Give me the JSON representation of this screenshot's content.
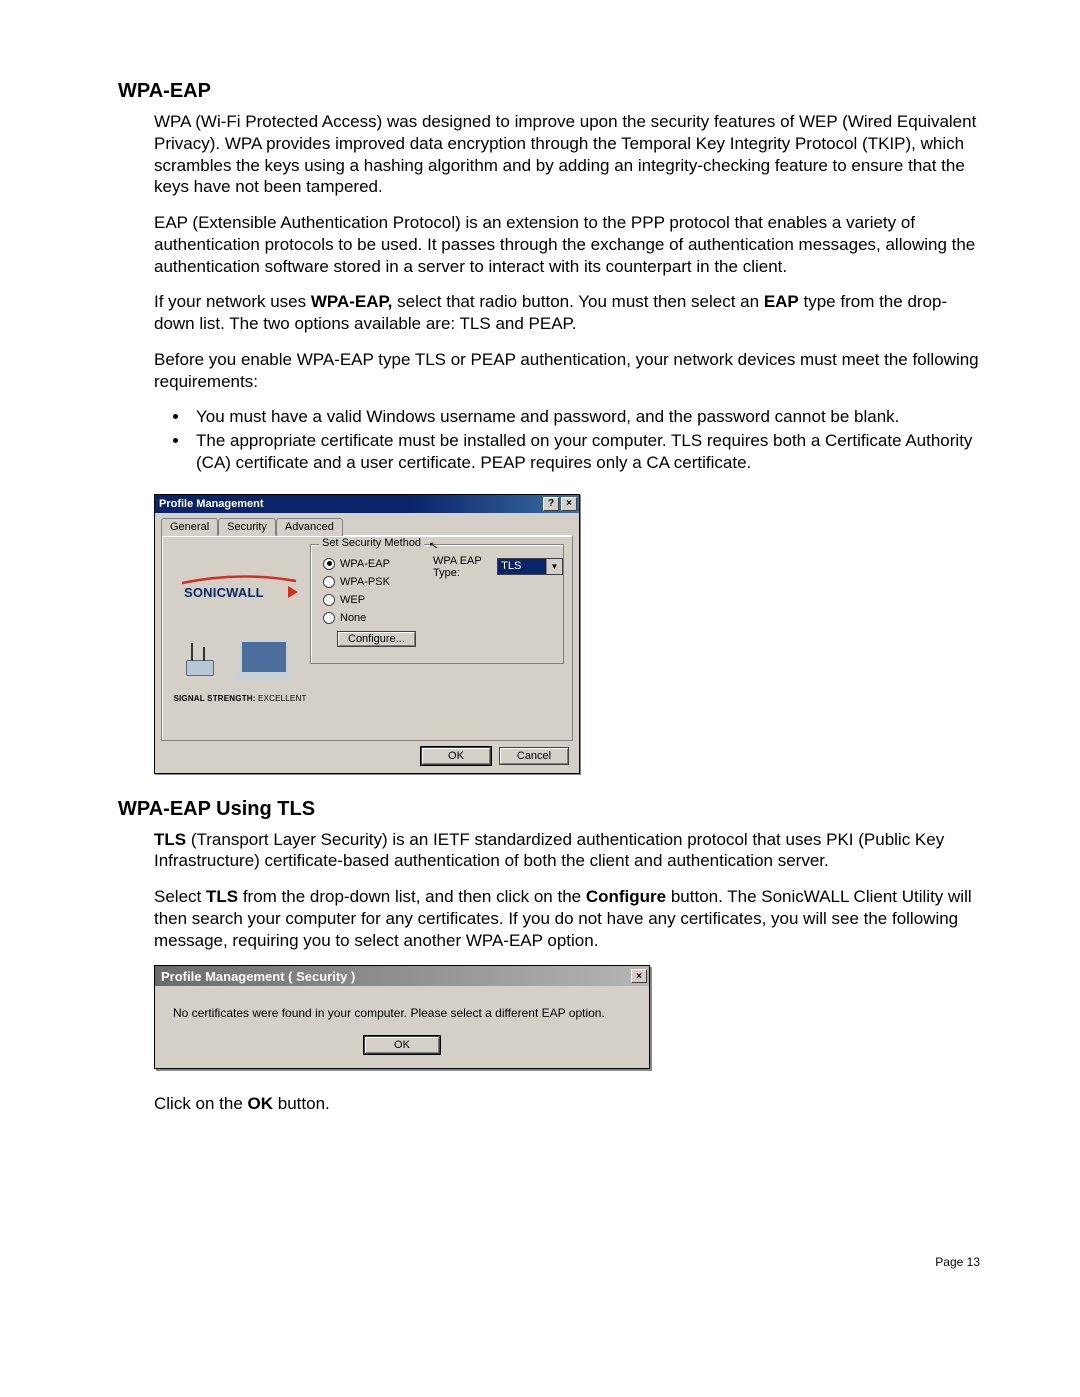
{
  "section1": {
    "heading": "WPA-EAP",
    "p1_a": "WPA (Wi-Fi Protected Access) was designed to improve upon the security features of WEP (Wired Equivalent Privacy). WPA provides improved data encryption through the Temporal Key Integrity Protocol (TKIP), which scrambles the keys using a hashing algorithm and by adding an integrity-checking feature to ensure that the keys have not been tampered.",
    "p2": "EAP (Extensible Authentication Protocol) is an extension to the PPP protocol that enables a variety of authentication protocols to be used. It passes through the exchange of authentication messages, allowing the authentication software stored in a server to interact with its counterpart in the client.",
    "p3_pre": "If your network uses ",
    "p3_b1": "WPA-EAP,",
    "p3_mid": " select that radio button. You must then select an ",
    "p3_b2": "EAP",
    "p3_post": " type from the drop-down list. The two options available are: TLS and PEAP.",
    "p4": "Before you enable WPA-EAP type TLS or PEAP authentication, your network devices must meet the following requirements:",
    "li1": "You must have a valid Windows username and password, and the password cannot be blank.",
    "li2": "The appropriate certificate must be installed on your computer. TLS requires both a Certificate Authority (CA) certificate and a user certificate. PEAP requires only a CA certificate."
  },
  "dialog1": {
    "title": "Profile Management",
    "help_btn": "?",
    "close_btn": "×",
    "tabs": {
      "general": "General",
      "security": "Security",
      "advanced": "Advanced"
    },
    "fieldset_legend": "Set Security Method",
    "radios": {
      "wpa_eap": "WPA-EAP",
      "wpa_psk": "WPA-PSK",
      "wep": "WEP",
      "none": "None"
    },
    "eap_type_label": "WPA EAP Type:",
    "eap_type_value": "TLS",
    "configure_btn": "Configure...",
    "logo_text": "SONICWALL",
    "signal_label": "SIGNAL STRENGTH:",
    "signal_value": " EXCELLENT",
    "ok_btn": "OK",
    "cancel_btn": "Cancel"
  },
  "section2": {
    "heading": "WPA-EAP Using TLS",
    "p1_b": "TLS",
    "p1_rest": " (Transport Layer Security) is an IETF standardized authentication protocol that uses PKI (Public Key Infrastructure) certificate-based authentication of both the client and authentication server.",
    "p2_a": "Select ",
    "p2_b1": "TLS",
    "p2_b": " from the drop-down list, and then click on the ",
    "p2_b2": "Configure",
    "p2_c": " button. The SonicWALL Client Utility will then search your computer for any certificates. If you do not have any certificates, you will see the following message, requiring you to select another WPA-EAP option.",
    "p3_a": "Click on the ",
    "p3_b": "OK",
    "p3_c": " button."
  },
  "dialog2": {
    "title": "Profile Management ( Security )",
    "close_btn": "×",
    "message": "No certificates were found in your computer.  Please select a different EAP option.",
    "ok_btn": "OK"
  },
  "footer": {
    "page": "Page 13"
  }
}
